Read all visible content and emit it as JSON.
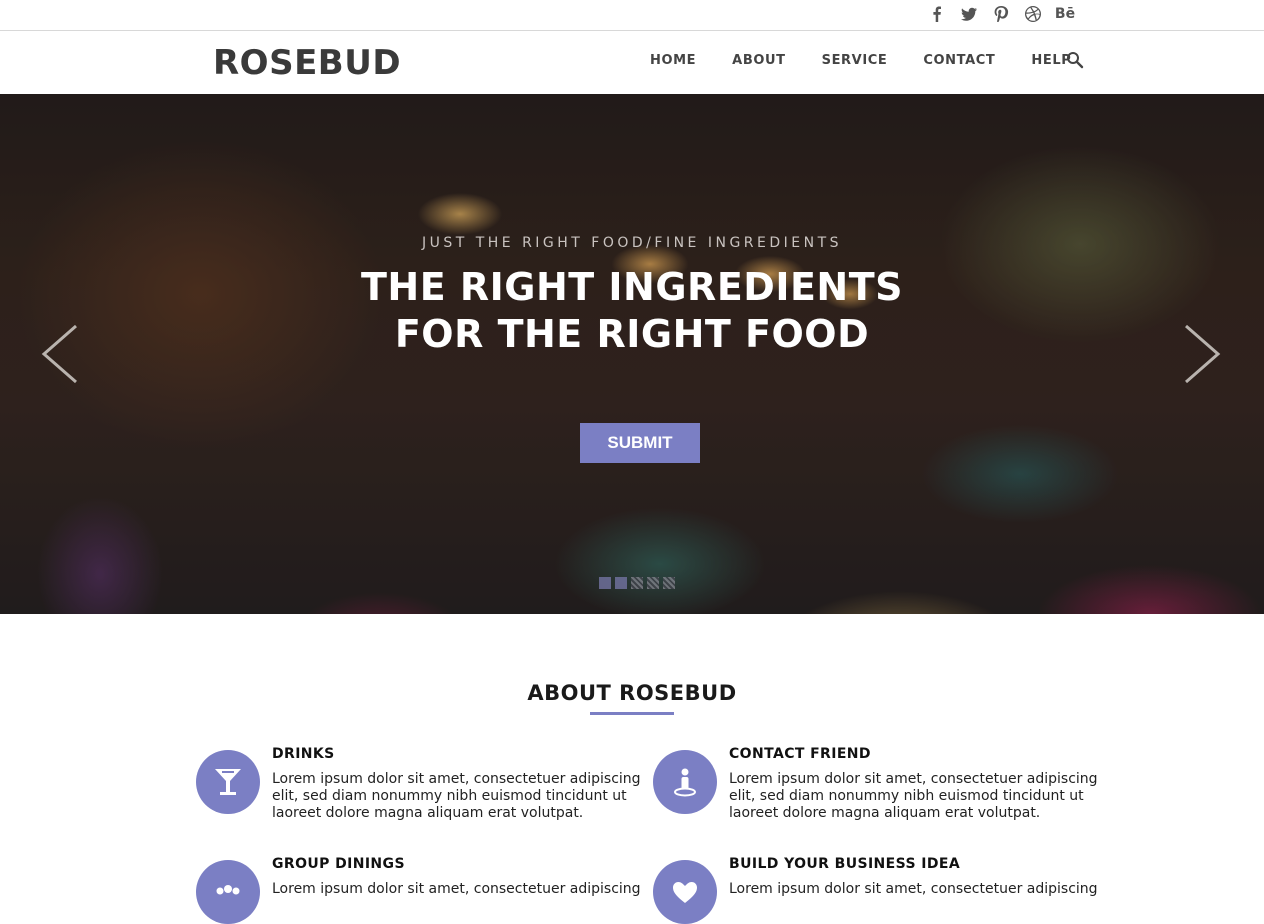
{
  "social": {
    "icons": [
      "facebook-icon",
      "twitter-icon",
      "pinterest-icon",
      "dribbble-icon",
      "behance-icon"
    ],
    "behance_label": "Bē"
  },
  "header": {
    "logo": "ROSEBUD",
    "nav": [
      "HOME",
      "ABOUT",
      "SERVICE",
      "CONTACT",
      "HELP"
    ]
  },
  "hero": {
    "subtitle": "JUST THE RIGHT FOOD/FINE INGREDIENTS",
    "title_line1": "THE RIGHT INGREDIENTS",
    "title_line2": "FOR THE RIGHT FOOD",
    "button": "SUBMIT",
    "slide_count": 5
  },
  "about": {
    "title": "ABOUT ROSEBUD",
    "features": [
      {
        "title": "DRINKS",
        "text": "Lorem ipsum dolor sit amet, consectetuer adipiscing elit, sed diam nonummy nibh euismod tincidunt ut laoreet dolore magna aliquam erat volutpat.",
        "icon": "cocktail-icon"
      },
      {
        "title": "CONTACT FRIEND",
        "text": "Lorem ipsum dolor sit amet, consectetuer adipiscing elit, sed diam nonummy nibh euismod tincidunt ut laoreet dolore magna aliquam erat volutpat.",
        "icon": "person-icon"
      },
      {
        "title": "GROUP DININGS",
        "text": "Lorem ipsum dolor sit amet, consectetuer adipiscing",
        "icon": "group-icon"
      },
      {
        "title": "BUILD YOUR BUSINESS IDEA",
        "text": "Lorem ipsum dolor sit amet, consectetuer adipiscing",
        "icon": "heart-pulse-icon"
      }
    ]
  },
  "colors": {
    "accent": "#7b7fc4",
    "logo": "#3a3a3a",
    "nav_text": "#444444"
  }
}
